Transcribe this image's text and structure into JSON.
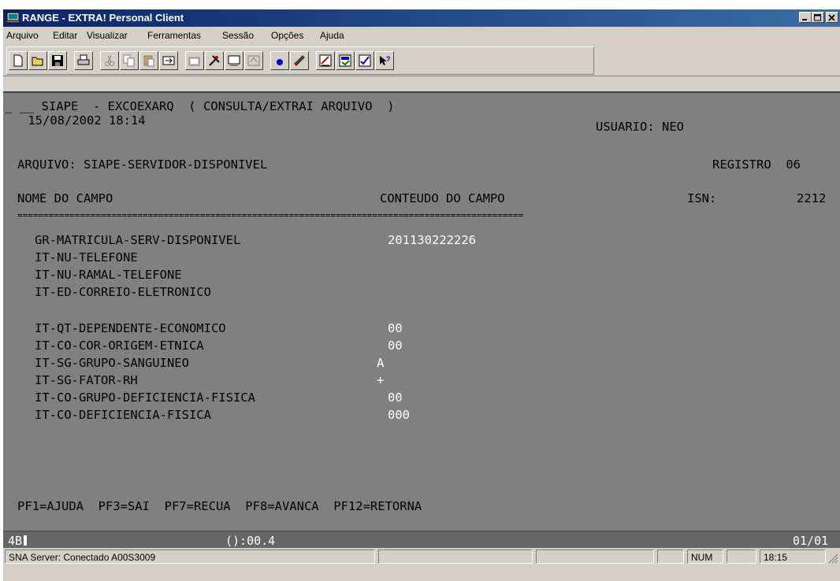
{
  "window": {
    "title": "RANGE - EXTRA! Personal Client",
    "icon": "terminal-app-icon",
    "controls": [
      "minimize-icon",
      "restore-icon",
      "close-icon"
    ]
  },
  "menu": [
    "Arquivo",
    "Editar",
    "Visualizar",
    "Ferramentas",
    "Sessão",
    "Opções",
    "Ajuda"
  ],
  "toolbar_icons": [
    "new-document-icon",
    "open-folder-icon",
    "save-icon",
    "print-icon",
    "cut-icon",
    "copy-icon",
    "paste-icon",
    "transfer-icon",
    "macro-icon",
    "tools-icon",
    "screen-icon",
    "display-icon",
    "record-icon",
    "keyboard-icon",
    "edit-icon",
    "settings-icon",
    "check-icon",
    "help-icon"
  ],
  "terminal": {
    "header_line1": "_ __ SIAPE  - EXCOEXARQ  ( CONSULTA/EXTRAI ARQUIVO  )",
    "datetime": " 15/08/2002 18:14",
    "user_label": "USUARIO: NEO",
    "file_label": "ARQUIVO: SIAPE-SERVIDOR-DISPONIVEL",
    "registro_label": "REGISTRO  06",
    "col_field": "NOME DO CAMPO",
    "col_content": "CONTEUDO DO CAMPO",
    "col_isn": "ISN:",
    "isn_value": "2212",
    "separator": "=================================================================================================",
    "fields": [
      {
        "name": "GR-MATRICULA-SERV-DISPONIVEL",
        "value": "201130222226"
      },
      {
        "name": "IT-NU-TELEFONE",
        "value": ""
      },
      {
        "name": "IT-NU-RAMAL-TELEFONE",
        "value": ""
      },
      {
        "name": "IT-ED-CORREIO-ELETRONICO",
        "value": ""
      },
      {
        "name": "IT-QT-DEPENDENTE-ECONOMICO",
        "value": "00"
      },
      {
        "name": "IT-CO-COR-ORIGEM-ETNICA",
        "value": "00"
      },
      {
        "name": "IT-SG-GRUPO-SANGUINEO",
        "value": "A"
      },
      {
        "name": "IT-SG-FATOR-RH",
        "value": "+"
      },
      {
        "name": "IT-CO-GRUPO-DEFICIENCIA-FISICA",
        "value": "00"
      },
      {
        "name": "IT-CO-DEFICIENCIA-FISICA",
        "value": "000"
      }
    ],
    "pf_keys": "PF1=AJUDA  PF3=SAI  PF7=RECUA  PF8=AVANCA  PF12=RETORNA"
  },
  "oia": {
    "session": "4B",
    "timer": "():00.4",
    "page": "01/01"
  },
  "statusbar": {
    "connection": "SNA Server: Conectado A00S3009",
    "num": "NUM",
    "time": "18:15"
  }
}
